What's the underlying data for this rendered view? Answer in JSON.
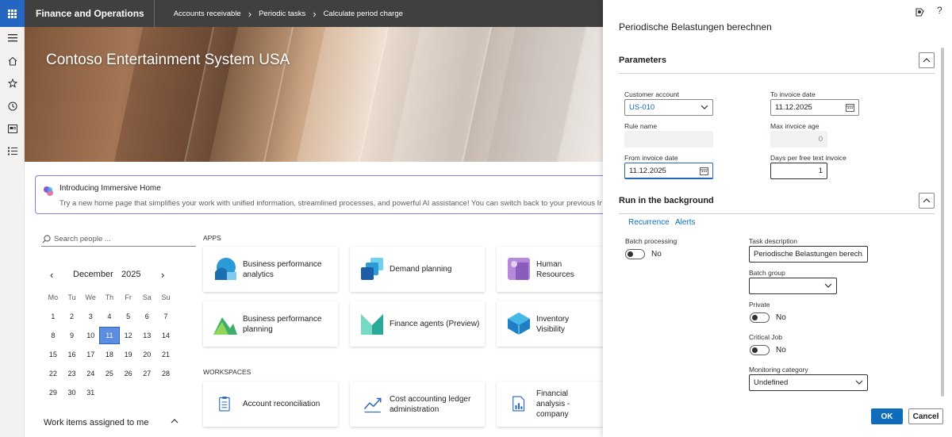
{
  "topbar": {
    "app_title": "Finance and Operations",
    "breadcrumbs": [
      "Accounts receivable",
      "Periodic tasks",
      "Calculate period charge"
    ]
  },
  "leftnav": {
    "icons": [
      "hamburger-icon",
      "home-icon",
      "star-icon",
      "recent-icon",
      "workspace-icon",
      "modules-icon"
    ]
  },
  "hero": {
    "company": "Contoso Entertainment System USA"
  },
  "banner": {
    "title": "Introducing Immersive Home",
    "text": "Try a new home page that simplifies your work with unified information, streamlined processes, and powerful AI assistance! You can switch back to your previous Initial page at"
  },
  "search": {
    "placeholder": "Search people ..."
  },
  "calendar": {
    "month": "December",
    "year": "2025",
    "days_of_week": [
      "Mo",
      "Tu",
      "We",
      "Th",
      "Fr",
      "Sa",
      "Su"
    ],
    "weeks": [
      [
        "1",
        "2",
        "3",
        "4",
        "5",
        "6",
        "7"
      ],
      [
        "8",
        "9",
        "10",
        "11",
        "12",
        "13",
        "14"
      ],
      [
        "15",
        "16",
        "17",
        "18",
        "19",
        "20",
        "21"
      ],
      [
        "22",
        "23",
        "24",
        "25",
        "26",
        "27",
        "28"
      ],
      [
        "29",
        "30",
        "31",
        "",
        "",
        "",
        ""
      ]
    ],
    "selected": "11"
  },
  "work_items": {
    "label": "Work items assigned to me"
  },
  "apps": {
    "label": "APPS",
    "tiles": [
      {
        "label": "Business performance analytics",
        "icon": "bpa-icon"
      },
      {
        "label": "Demand planning",
        "icon": "demand-planning-icon"
      },
      {
        "label": "Human Resources",
        "icon": "human-resources-icon"
      },
      {
        "label": "Business performance planning",
        "icon": "bpp-icon"
      },
      {
        "label": "Finance agents (Preview)",
        "icon": "finance-agents-icon"
      },
      {
        "label": "Inventory Visibility",
        "icon": "inventory-visibility-icon"
      }
    ]
  },
  "workspaces": {
    "label": "WORKSPACES",
    "tiles": [
      {
        "label": "Account reconciliation",
        "icon": "clipboard-icon"
      },
      {
        "label": "Cost accounting ledger administration",
        "icon": "trend-icon"
      },
      {
        "label": "Financial analysis - company",
        "icon": "report-icon"
      }
    ]
  },
  "panel": {
    "title": "Periodische Belastungen berechnen",
    "parameters": {
      "heading": "Parameters",
      "customer_account_label": "Customer account",
      "customer_account_value": "US-010",
      "to_invoice_date_label": "To invoice date",
      "to_invoice_date_value": "11.12.2025",
      "rule_name_label": "Rule name",
      "rule_name_value": "",
      "max_invoice_age_label": "Max invoice age",
      "max_invoice_age_value": "0",
      "from_invoice_date_label": "From invoice date",
      "from_invoice_date_value": "11.12.2025",
      "days_per_free_text_label": "Days per free text invoice",
      "days_per_free_text_value": "1"
    },
    "background": {
      "heading": "Run in the background",
      "recurrence": "Recurrence",
      "alerts": "Alerts",
      "batch_processing_label": "Batch processing",
      "batch_processing_value": "No",
      "task_description_label": "Task description",
      "task_description_value": "Periodische Belastungen berech...",
      "batch_group_label": "Batch group",
      "batch_group_value": "",
      "private_label": "Private",
      "private_value": "No",
      "critical_job_label": "Critical Job",
      "critical_job_value": "No",
      "monitoring_category_label": "Monitoring category",
      "monitoring_category_value": "Undefined"
    },
    "ok": "OK",
    "cancel": "Cancel"
  },
  "colors": {
    "accent": "#0f6cbd",
    "topbar": "#404040",
    "waffle": "#2566c2"
  }
}
